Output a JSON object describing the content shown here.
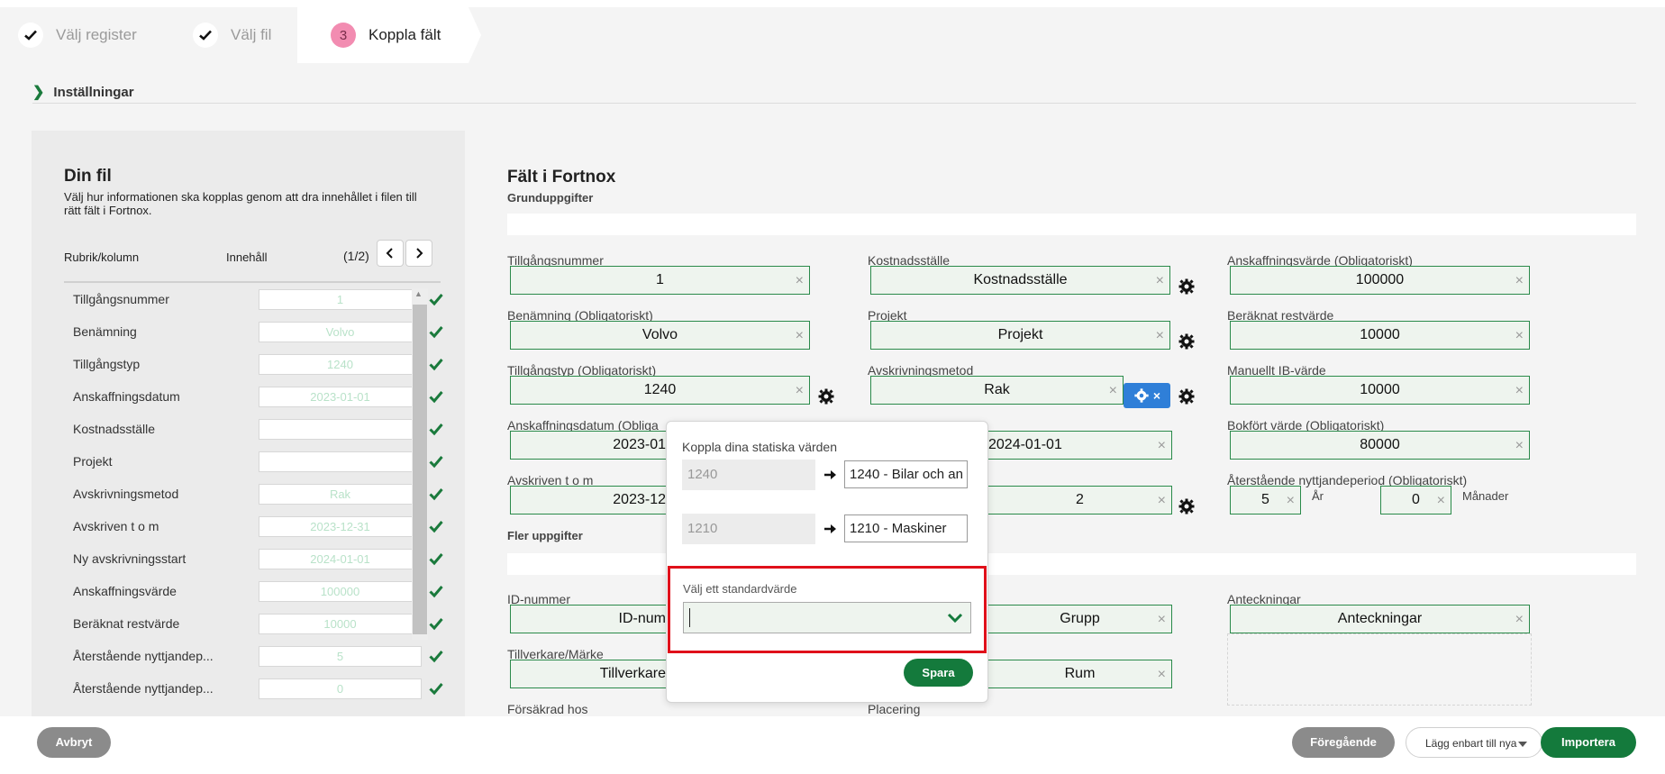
{
  "stepper": {
    "steps": [
      {
        "label": "Välj register",
        "state": "done"
      },
      {
        "label": "Välj fil",
        "state": "done"
      },
      {
        "number": "3",
        "label": "Koppla fält",
        "state": "active"
      }
    ]
  },
  "settings": {
    "label": "Inställningar"
  },
  "left_panel": {
    "title": "Din fil",
    "description": "Välj hur informationen ska kopplas genom att dra innehållet i filen till rätt fält i Fortnox.",
    "col_header": "Rubrik/kolumn",
    "content_header": "Innehåll",
    "pagination": "(1/2)",
    "rows": [
      {
        "name": "Tillgångsnummer",
        "value": "1"
      },
      {
        "name": "Benämning",
        "value": "Volvo"
      },
      {
        "name": "Tillgångstyp",
        "value": "1240"
      },
      {
        "name": "Anskaffningsdatum",
        "value": "2023-01-01"
      },
      {
        "name": "Kostnadsställe",
        "value": ""
      },
      {
        "name": "Projekt",
        "value": ""
      },
      {
        "name": "Avskrivningsmetod",
        "value": "Rak"
      },
      {
        "name": "Avskriven t o m",
        "value": "2023-12-31"
      },
      {
        "name": "Ny avskrivningsstart",
        "value": "2024-01-01"
      },
      {
        "name": "Anskaffningsvärde",
        "value": "100000"
      },
      {
        "name": "Beräknat restvärde",
        "value": "10000"
      },
      {
        "name": "Återstående nyttjandep...",
        "value": "5"
      },
      {
        "name": "Återstående nyttjandep...",
        "value": "0"
      }
    ]
  },
  "right_panel": {
    "title": "Fält i Fortnox",
    "section_basic": "Grunduppgifter",
    "section_more": "Fler uppgifter",
    "fields": {
      "tillgangsnummer": {
        "label": "Tillgångsnummer",
        "value": "1"
      },
      "benamning": {
        "label": "Benämning (Obligatoriskt)",
        "value": "Volvo"
      },
      "tillgangstyp": {
        "label": "Tillgångstyp (Obligatoriskt)",
        "value": "1240"
      },
      "anskaffningsdatum": {
        "label": "Anskaffningsdatum (Obliga",
        "value": "2023-01"
      },
      "avskriven": {
        "label": "Avskriven t o m",
        "value": "2023-12"
      },
      "kostnadsstalle": {
        "label": "Kostnadsställe",
        "value": "Kostnadsställe"
      },
      "projekt": {
        "label": "Projekt",
        "value": "Projekt"
      },
      "avskrivningsmetod": {
        "label": "Avskrivningsmetod",
        "value": "Rak"
      },
      "nyavskrivningsstart": {
        "value": "2024-01-01"
      },
      "col2row5": {
        "value": "2"
      },
      "anskaffningsvarde": {
        "label": "Anskaffningsvärde (Obligatoriskt)",
        "value": "100000"
      },
      "beraknat_restvarde": {
        "label": "Beräknat restvärde",
        "value": "10000"
      },
      "manuellt_ib": {
        "label": "Manuellt IB-värde",
        "value": "10000"
      },
      "bokfort_varde": {
        "label": "Bokfört värde (Obligatoriskt)",
        "value": "80000"
      },
      "aterstaende": {
        "label": "Återstående nyttjandeperiod (Obligatoriskt)",
        "years": "5",
        "years_unit": "År",
        "months": "0",
        "months_unit": "Månader"
      },
      "id_nummer": {
        "label": "ID-nummer",
        "value": "ID-num"
      },
      "tillverkare": {
        "label": "Tillverkare/Märke",
        "value": "Tillverkare"
      },
      "forsakrad": {
        "label": "Försäkrad hos"
      },
      "grupp": {
        "value": "Grupp"
      },
      "rum": {
        "value": "Rum"
      },
      "placering": {
        "label": "Placering"
      },
      "anteckningar": {
        "label": "Anteckningar",
        "value": "Anteckningar"
      }
    }
  },
  "popover": {
    "title": "Koppla dina statiska värden",
    "mappings": [
      {
        "source": "1240",
        "target": "1240 - Bilar och an"
      },
      {
        "source": "1210",
        "target": "1210 - Maskiner"
      }
    ],
    "standard_label": "Välj ett standardvärde",
    "standard_value": "",
    "save": "Spara"
  },
  "footer": {
    "cancel": "Avbryt",
    "previous": "Föregående",
    "mode": "Lägg enbart till nya",
    "import": "Importera"
  },
  "colors": {
    "accent_green": "#147a3c",
    "step_active": "#f28cb1",
    "highlight_red": "#e0101a",
    "blue_button": "#2f7fd8"
  }
}
